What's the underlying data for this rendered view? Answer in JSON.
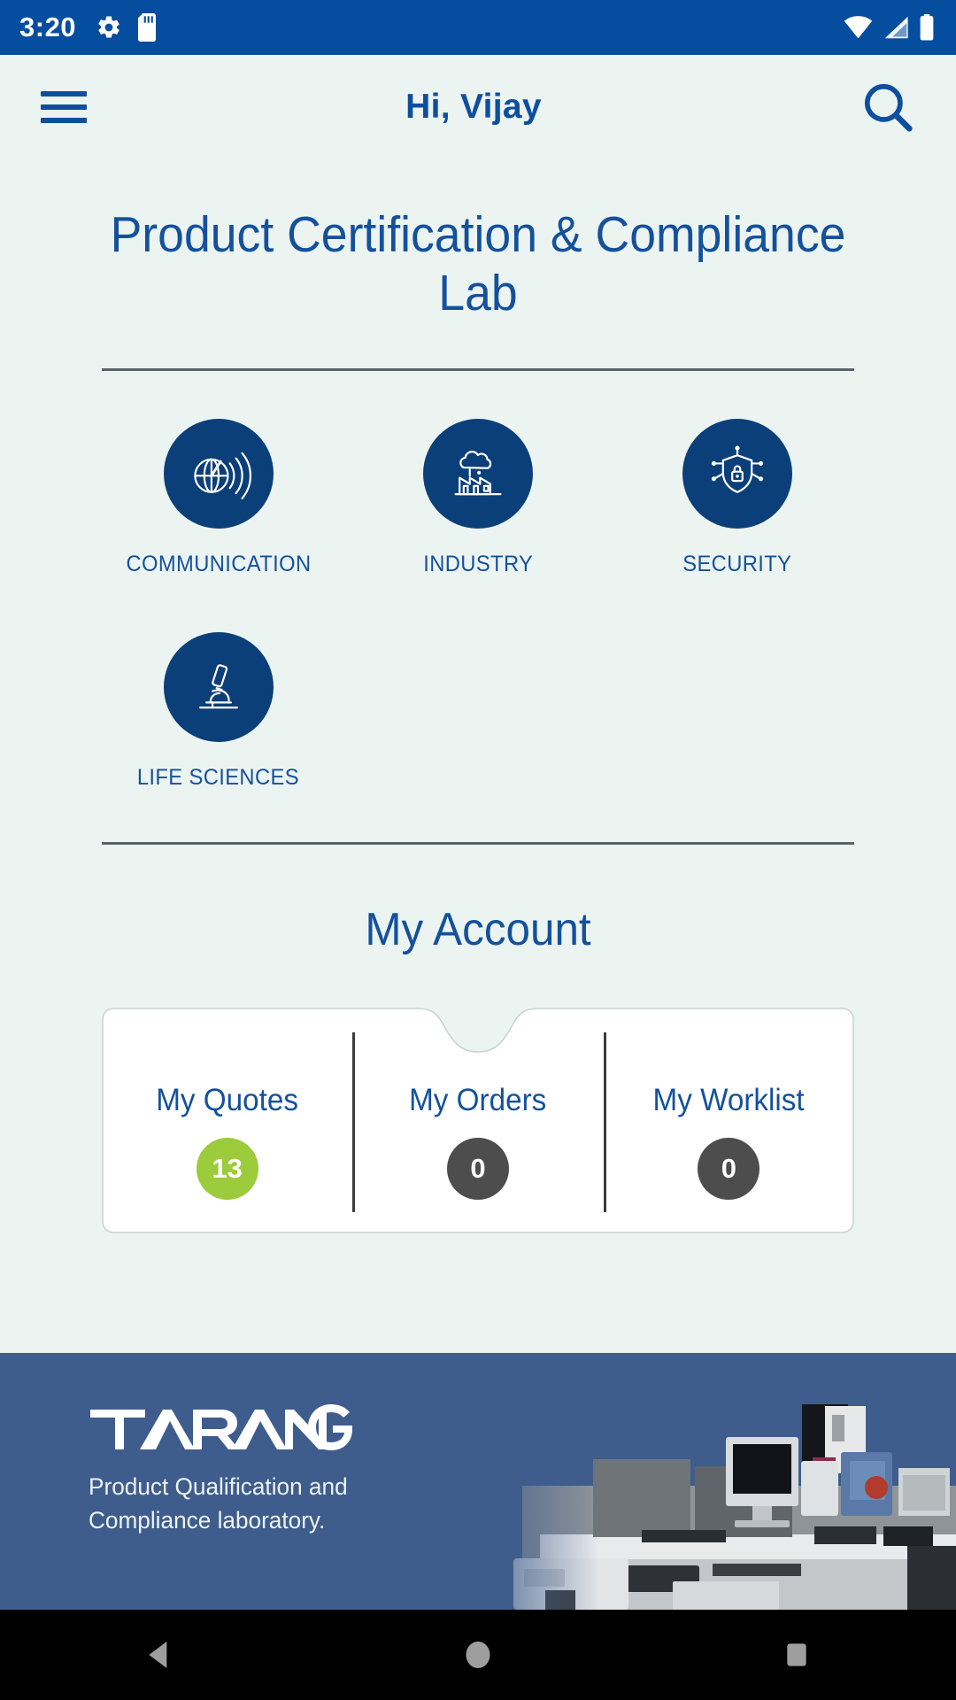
{
  "status_bar": {
    "time": "3:20",
    "left_icons": [
      "gear-icon",
      "sd-card-icon"
    ],
    "right_icons": [
      "wifi-icon",
      "cellular-signal-icon",
      "battery-icon"
    ],
    "background_color": "#054d9e"
  },
  "app_bar": {
    "menu_icon": "hamburger-menu-icon",
    "greeting": "Hi, Vijay",
    "search_icon": "search-icon"
  },
  "page": {
    "title": "Product Certification & Compliance Lab",
    "title_color": "#14519c",
    "background_color": "#ecf4f2"
  },
  "categories": [
    {
      "label": "COMMUNICATION",
      "icon": "satellite-globe-icon"
    },
    {
      "label": "INDUSTRY",
      "icon": "factory-icon"
    },
    {
      "label": "SECURITY",
      "icon": "shield-lock-network-icon"
    },
    {
      "label": "LIFE SCIENCES",
      "icon": "microscope-icon"
    }
  ],
  "my_account": {
    "heading": "My Account",
    "items": [
      {
        "label": "My Quotes",
        "count": "13",
        "badge_color": "#9ccb3b"
      },
      {
        "label": "My Orders",
        "count": "0",
        "badge_color": "#4d4d4d"
      },
      {
        "label": "My Worklist",
        "count": "0",
        "badge_color": "#4d4d4d"
      }
    ]
  },
  "footer_banner": {
    "logo_text": "TARANG",
    "tagline_line1": "Product Qualification and",
    "tagline_line2": "Compliance laboratory.",
    "background_color": "#3e5d8c",
    "photo": "laboratory-equipment-photo"
  },
  "nav_bar": {
    "back": "back-triangle-icon",
    "home": "home-circle-icon",
    "recents": "recents-square-icon"
  }
}
